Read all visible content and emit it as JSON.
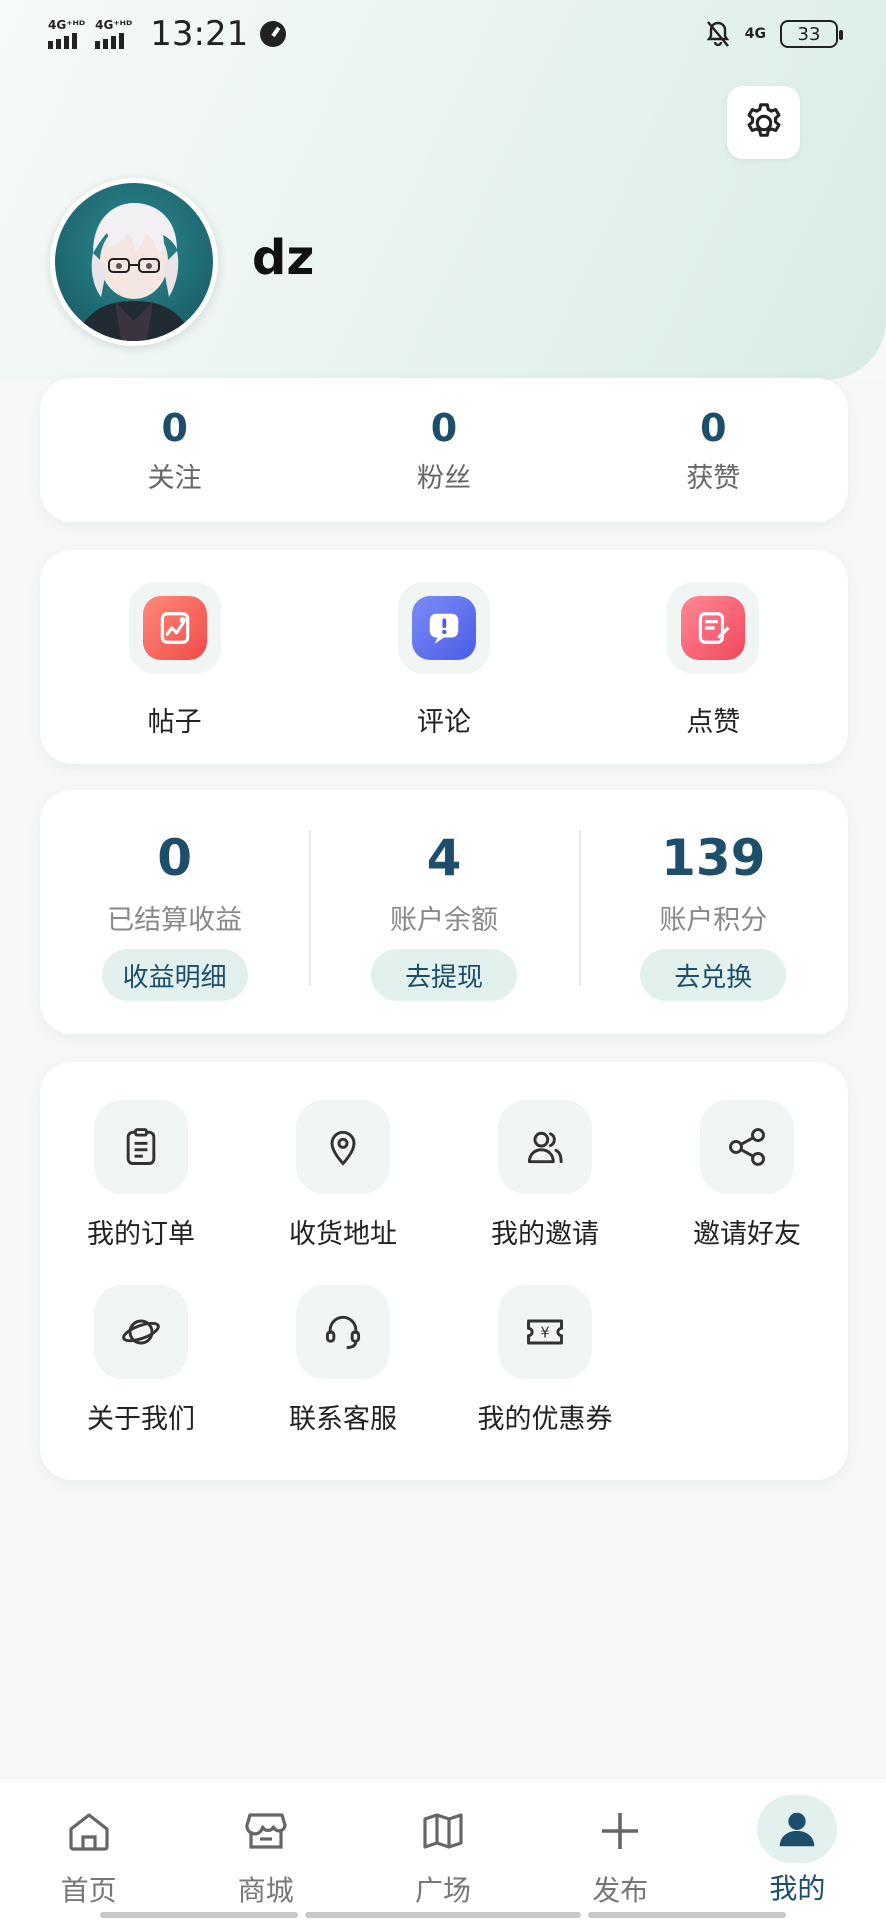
{
  "status_bar": {
    "sim1": "4G⁺ᴴᴰ",
    "sim2": "4G⁺ᴴᴰ",
    "time": "13:21",
    "network": "4G",
    "battery": "33"
  },
  "profile": {
    "username": "dz"
  },
  "stats": [
    {
      "value": "0",
      "label": "关注"
    },
    {
      "value": "0",
      "label": "粉丝"
    },
    {
      "value": "0",
      "label": "获赞"
    }
  ],
  "quick_actions": [
    {
      "label": "帖子",
      "icon": "posts-icon",
      "color": "#f26464"
    },
    {
      "label": "评论",
      "icon": "comment-icon",
      "color": "#5b6ff0"
    },
    {
      "label": "点赞",
      "icon": "like-icon",
      "color": "#f25c6e"
    }
  ],
  "wallet": [
    {
      "value": "0",
      "label": "已结算收益",
      "action": "收益明细"
    },
    {
      "value": "4",
      "label": "账户余额",
      "action": "去提现"
    },
    {
      "value": "139",
      "label": "账户积分",
      "action": "去兑换"
    }
  ],
  "services": [
    {
      "label": "我的订单",
      "icon": "clipboard-icon"
    },
    {
      "label": "收货地址",
      "icon": "location-pin-icon"
    },
    {
      "label": "我的邀请",
      "icon": "users-icon"
    },
    {
      "label": "邀请好友",
      "icon": "share-icon"
    },
    {
      "label": "关于我们",
      "icon": "planet-icon"
    },
    {
      "label": "联系客服",
      "icon": "headset-icon"
    },
    {
      "label": "我的优惠券",
      "icon": "coupon-icon"
    }
  ],
  "tabbar": [
    {
      "label": "首页",
      "icon": "home-icon"
    },
    {
      "label": "商城",
      "icon": "store-icon"
    },
    {
      "label": "广场",
      "icon": "map-icon"
    },
    {
      "label": "发布",
      "icon": "plus-icon"
    },
    {
      "label": "我的",
      "icon": "user-icon",
      "active": true
    }
  ],
  "colors": {
    "accent": "#1d4e6b",
    "pill_bg": "#e3f1ee"
  }
}
